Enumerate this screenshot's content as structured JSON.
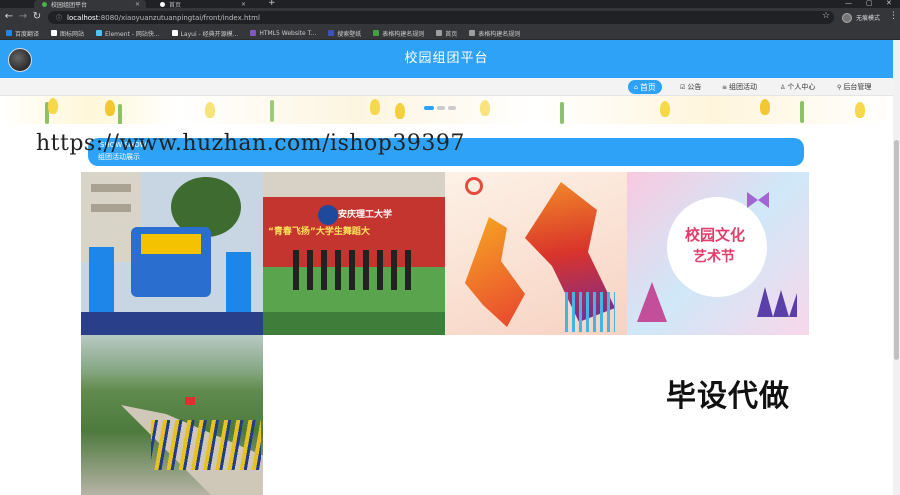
{
  "browser": {
    "active_tab_title": "校园组团平台",
    "inactive_tab_title": "首页",
    "new_tab": "+",
    "url_host": "localhost",
    "url_rest": ":8080/xiaoyuanzutuanpingtai/front/index.html",
    "profile_label": "无痕模式",
    "bookmarks": [
      "百度翻译",
      "图标网站",
      "Element - 网站快...",
      "Layui - 经典开源模...",
      "HTML5 Website T...",
      "搜索壁纸",
      "表格构建名规则",
      "首页",
      "表格构建名规则"
    ],
    "bookmark_colors": [
      "#1e88e5",
      "#ffffff",
      "#4fc3f7",
      "#ffffff",
      "#7e57c2",
      "#3f51b5",
      "#43a047",
      "#9e9e9e",
      "#9e9e9e"
    ]
  },
  "site": {
    "title": "校园组团平台",
    "brand_color": "#2ea2f6",
    "nav": [
      {
        "label": "首页",
        "icon": "⌂",
        "active": true
      },
      {
        "label": "公告",
        "icon": "☑",
        "active": false
      },
      {
        "label": "组团活动",
        "icon": "≡",
        "active": false
      },
      {
        "label": "个人中心",
        "icon": "♙",
        "active": false
      },
      {
        "label": "后台管理",
        "icon": "⚲",
        "active": false
      }
    ],
    "show_bar_en": "SHOW SHOW",
    "show_bar_cn": "组团活动展示",
    "tile_texts": [
      "安庆理工大学",
      "“青春飞扬”大学生舞蹈大",
      "校园文化",
      "艺术节"
    ],
    "promo": "毕设代做",
    "watermark": "https://www.huzhan.com/ishop39397"
  }
}
